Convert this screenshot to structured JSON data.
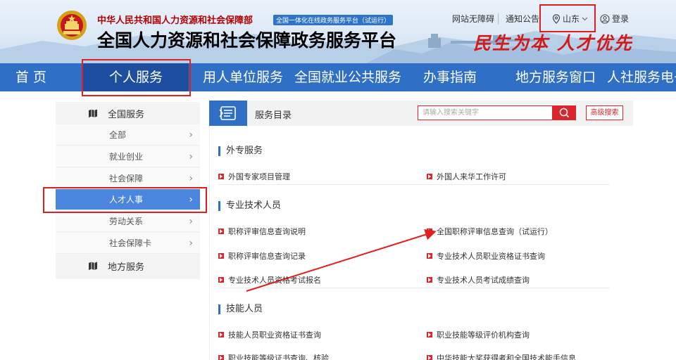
{
  "header": {
    "org_name": "中华人民共和国人力资源和社会保障部",
    "org_badge": "全国一体化在线政务服务平台（试运行）",
    "platform_title": "全国人力资源和社会保障政务服务平台",
    "slogan": "民生为本 人才优先",
    "top_links": {
      "accessibility": "网站无障碍",
      "notice": "通知公告",
      "region": "山东",
      "login": "登录"
    }
  },
  "nav": {
    "items": [
      "首 页",
      "个人服务",
      "用人单位服务",
      "全国就业公共服务",
      "办事指南",
      "地方服务窗口",
      "人社服务电子"
    ],
    "active_index": 1
  },
  "sidebar": {
    "national_label": "全国服务",
    "items": [
      "全部",
      "就业创业",
      "社会保障",
      "人才人事",
      "劳动关系",
      "社会保障卡"
    ],
    "active_index": 3,
    "local_label": "地方服务"
  },
  "catalog": {
    "title": "服务目录",
    "search_placeholder": "请输入搜索关键字",
    "advanced_search": "高级搜索"
  },
  "sections": [
    {
      "title": "外专服务",
      "links": [
        "外国专家项目管理",
        "外国人来华工作许可"
      ]
    },
    {
      "title": "专业技术人员",
      "links": [
        "职称评审信息查询说明",
        "全国职称评审信息查询（试运行）",
        "职称评审信息查询记录",
        "专业技术人员职业资格证书查询",
        "专业技术人员资格考试报名",
        "专业技术人员考试成绩查询"
      ]
    },
    {
      "title": "技能人员",
      "links": [
        "技能人员职业资格证书查询",
        "职业技能等级评价机构查询",
        "职业技能等级证书查询、核验",
        "中华技能大奖获得者和全国技术能手信息"
      ]
    }
  ],
  "colors": {
    "nav_blue": "#2f6fc6",
    "nav_active": "#1d4ea0",
    "accent_red": "#d9252b",
    "highlight_red": "#e02020",
    "sidebar_active": "#4a86dd"
  }
}
